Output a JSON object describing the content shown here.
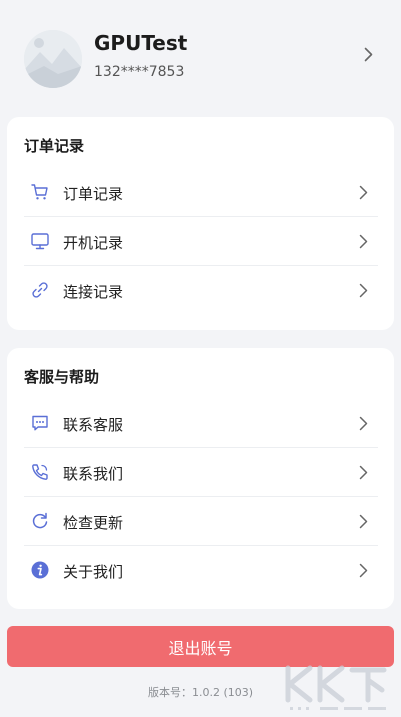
{
  "profile": {
    "username": "GPUTest",
    "phone": "132****7853"
  },
  "orders": {
    "title": "订单记录",
    "items": [
      {
        "label": "订单记录",
        "icon": "cart-icon"
      },
      {
        "label": "开机记录",
        "icon": "monitor-icon"
      },
      {
        "label": "连接记录",
        "icon": "link-icon"
      }
    ]
  },
  "support": {
    "title": "客服与帮助",
    "items": [
      {
        "label": "联系客服",
        "icon": "chat-icon"
      },
      {
        "label": "联系我们",
        "icon": "phone-icon"
      },
      {
        "label": "检查更新",
        "icon": "refresh-icon"
      },
      {
        "label": "关于我们",
        "icon": "info-icon"
      }
    ]
  },
  "logout_label": "退出账号",
  "version": "版本号：1.0.2 (103)",
  "colors": {
    "accent_blue": "#5a6fd6",
    "logout_red": "#f06b6f",
    "background": "#f3f4f7"
  }
}
